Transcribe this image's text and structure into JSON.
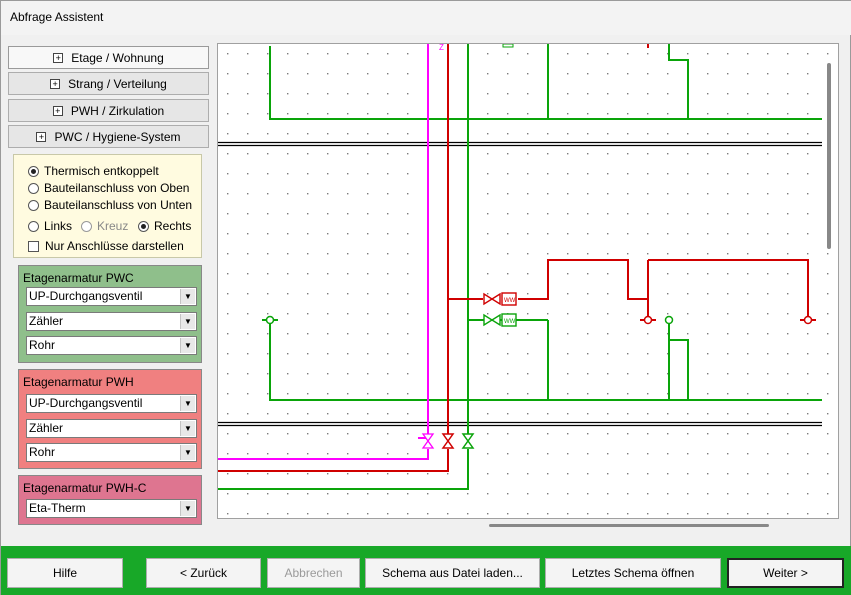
{
  "window": {
    "title": "Abfrage Assistent"
  },
  "accordion": [
    {
      "label": "Etage / Wohnung",
      "active": true
    },
    {
      "label": "Strang / Verteilung",
      "active": false
    },
    {
      "label": "PWH / Zirkulation",
      "active": false
    },
    {
      "label": "PWC / Hygiene-System",
      "active": false
    }
  ],
  "options": {
    "thermisch": "Thermisch entkoppelt",
    "oben": "Bauteilanschluss von Oben",
    "unten": "Bauteilanschluss von Unten",
    "links": "Links",
    "kreuz": "Kreuz",
    "rechts": "Rechts",
    "nur": "Nur Anschlüsse darstellen"
  },
  "groups": {
    "pwc": {
      "title": "Etagenarmatur PWC",
      "color": "#8fbf8b",
      "values": [
        "UP-Durchgangsventil",
        "Zähler",
        "Rohr"
      ]
    },
    "pwh": {
      "title": "Etagenarmatur PWH",
      "color": "#f08080",
      "values": [
        "UP-Durchgangsventil",
        "Zähler",
        "Rohr"
      ]
    },
    "pwhc": {
      "title": "Etagenarmatur PWH-C",
      "color": "#de7590",
      "values": [
        "Eta-Therm"
      ]
    }
  },
  "diagram": {
    "label_z": "Z",
    "meter_label": "WW"
  },
  "footer": {
    "hilfe": "Hilfe",
    "zurueck": "< Zurück",
    "abbrechen": "Abbrechen",
    "schema_laden": "Schema aus Datei laden...",
    "letztes": "Letztes Schema öffnen",
    "weiter": "Weiter >"
  },
  "colors": {
    "pwc": "#0aa40a",
    "pwh": "#d00000",
    "pwhc": "#ff00ff",
    "footer": "#18a828"
  }
}
